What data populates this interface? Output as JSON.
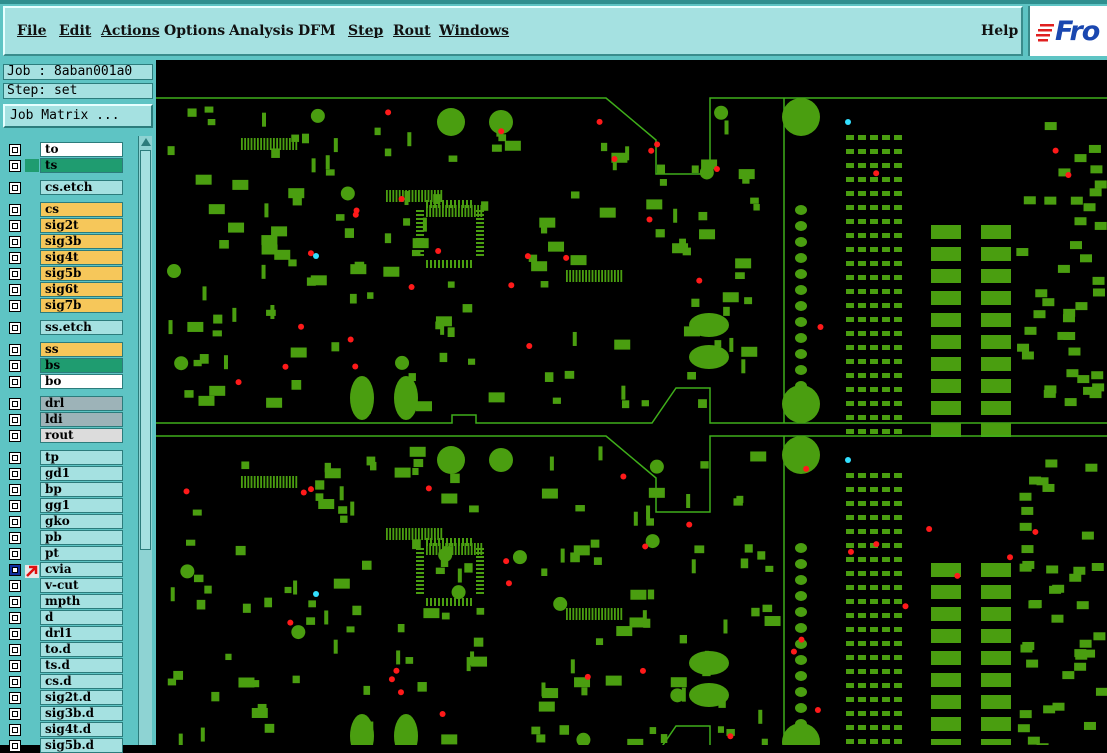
{
  "menu": {
    "items": [
      {
        "label": "File"
      },
      {
        "label": "Edit"
      },
      {
        "label": "Actions"
      },
      {
        "label": "Options"
      },
      {
        "label": "Analysis"
      },
      {
        "label": "DFM"
      },
      {
        "label": "Step"
      },
      {
        "label": "Rout"
      },
      {
        "label": "Windows"
      }
    ],
    "help": "Help"
  },
  "logo": {
    "text": "Fro"
  },
  "job": {
    "label": "Job : 8aban001a0"
  },
  "step": {
    "label": "Step: set"
  },
  "job_matrix": {
    "label": "Job Matrix ..."
  },
  "layers": [
    {
      "name": "to",
      "color": "white",
      "state": "none"
    },
    {
      "name": "ts",
      "color": "teal",
      "state": "green"
    },
    {
      "name": "cs.etch",
      "color": "cyan",
      "state": "none"
    },
    {
      "name": "cs",
      "color": "orange",
      "state": "none"
    },
    {
      "name": "sig2t",
      "color": "orange",
      "state": "none"
    },
    {
      "name": "sig3b",
      "color": "orange",
      "state": "none"
    },
    {
      "name": "sig4t",
      "color": "orange",
      "state": "none"
    },
    {
      "name": "sig5b",
      "color": "orange",
      "state": "none"
    },
    {
      "name": "sig6t",
      "color": "orange",
      "state": "none"
    },
    {
      "name": "sig7b",
      "color": "orange",
      "state": "none"
    },
    {
      "name": "ss.etch",
      "color": "cyan",
      "state": "none"
    },
    {
      "name": "ss",
      "color": "orange",
      "state": "none"
    },
    {
      "name": "bs",
      "color": "teal",
      "state": "none"
    },
    {
      "name": "bo",
      "color": "white",
      "state": "none"
    },
    {
      "name": "drl",
      "color": "gray",
      "state": "none"
    },
    {
      "name": "ldi",
      "color": "gray",
      "state": "none"
    },
    {
      "name": "rout",
      "color": "lgray",
      "state": "none"
    },
    {
      "name": "tp",
      "color": "cyan",
      "state": "none"
    },
    {
      "name": "gd1",
      "color": "cyan",
      "state": "none"
    },
    {
      "name": "bp",
      "color": "cyan",
      "state": "none"
    },
    {
      "name": "gg1",
      "color": "cyan",
      "state": "none"
    },
    {
      "name": "gko",
      "color": "cyan",
      "state": "none"
    },
    {
      "name": "pb",
      "color": "cyan",
      "state": "none"
    },
    {
      "name": "pt",
      "color": "cyan",
      "state": "none"
    },
    {
      "name": "cvia",
      "color": "cyan",
      "state": "work"
    },
    {
      "name": "v-cut",
      "color": "cyan",
      "state": "none"
    },
    {
      "name": "mpth",
      "color": "cyan",
      "state": "none"
    },
    {
      "name": "d",
      "color": "cyan",
      "state": "none"
    },
    {
      "name": "drl1",
      "color": "cyan",
      "state": "none"
    },
    {
      "name": "to.d",
      "color": "cyan",
      "state": "none"
    },
    {
      "name": "ts.d",
      "color": "cyan",
      "state": "none"
    },
    {
      "name": "cs.d",
      "color": "cyan",
      "state": "none"
    },
    {
      "name": "sig2t.d",
      "color": "cyan",
      "state": "none"
    },
    {
      "name": "sig3b.d",
      "color": "cyan",
      "state": "none"
    },
    {
      "name": "sig4t.d",
      "color": "cyan",
      "state": "none"
    },
    {
      "name": "sig5b.d",
      "color": "cyan",
      "state": "none"
    }
  ],
  "colors": {
    "pad_green": "#4a9e10",
    "outline_green": "#3fae1a",
    "drill_red": "#ff1a1a",
    "fiducial_cyan": "#33e0ff",
    "panel_teal": "#5ec4c4"
  }
}
